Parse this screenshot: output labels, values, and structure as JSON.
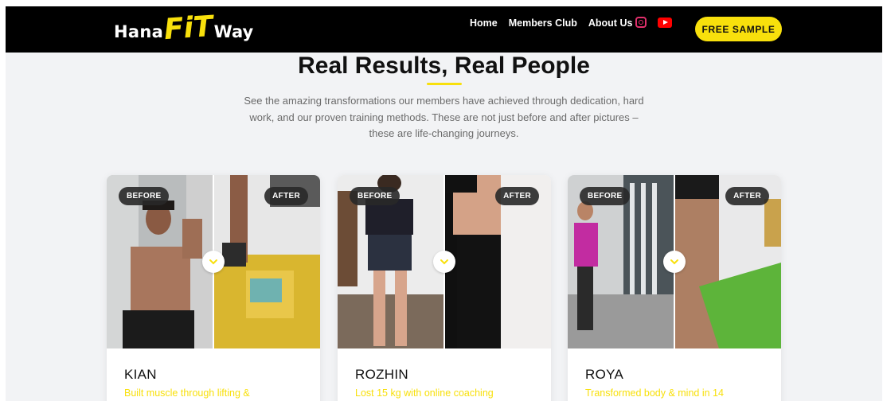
{
  "brand": {
    "logo_prefix": "Hana",
    "logo_mid": "FiT",
    "logo_suffix": "Way"
  },
  "nav": {
    "links": [
      "Home",
      "Members Club",
      "About Us"
    ],
    "social": [
      "instagram-icon",
      "youtube-icon"
    ],
    "cta_label": "FREE SAMPLE"
  },
  "section": {
    "title": "Real Results, Real People",
    "description": "See the amazing transformations our members have achieved through dedication, hard work, and our proven training methods. These are not just before and after pictures – these are life-changing journeys."
  },
  "cards": [
    {
      "before_label": "BEFORE",
      "after_label": "AFTER",
      "name": "KIAN",
      "subtitle": "Built muscle through lifting &"
    },
    {
      "before_label": "BEFORE",
      "after_label": "AFTER",
      "name": "ROZHIN",
      "subtitle": "Lost 15 kg with online coaching"
    },
    {
      "before_label": "BEFORE",
      "after_label": "AFTER",
      "name": "ROYA",
      "subtitle": "Transformed body & mind in 14"
    }
  ],
  "colors": {
    "accent": "#f8e00c",
    "header_bg": "#000000",
    "page_bg": "#f2f3f5",
    "text_muted": "#6b6b6b"
  }
}
